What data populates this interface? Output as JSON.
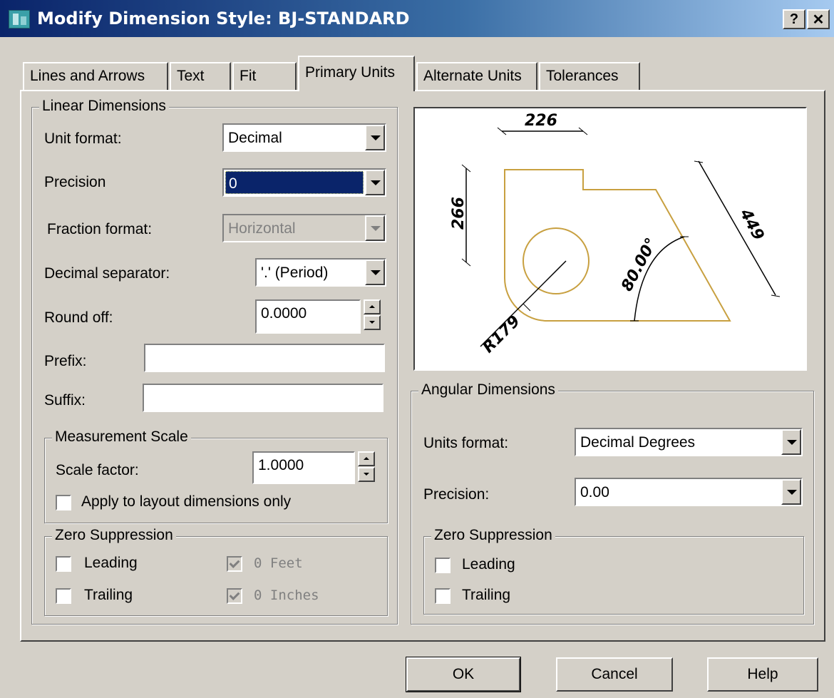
{
  "window": {
    "title": "Modify Dimension Style: BJ-STANDARD",
    "help_glyph": "?",
    "close_glyph": "✕"
  },
  "tabs": [
    {
      "label": "Lines and Arrows",
      "active": false
    },
    {
      "label": "Text",
      "active": false
    },
    {
      "label": "Fit",
      "active": false
    },
    {
      "label": "Primary Units",
      "active": true
    },
    {
      "label": "Alternate Units",
      "active": false
    },
    {
      "label": "Tolerances",
      "active": false
    }
  ],
  "linear": {
    "legend": "Linear Dimensions",
    "unit_format_label": "Unit format:",
    "unit_format_value": "Decimal",
    "precision_label": "Precision",
    "precision_value": "0",
    "fraction_label": "Fraction format:",
    "fraction_value": "Horizontal",
    "decimal_sep_label": "Decimal separator:",
    "decimal_sep_value": "'.' (Period)",
    "round_off_label": "Round off:",
    "round_off_value": "0.0000",
    "prefix_label": "Prefix:",
    "prefix_value": "",
    "suffix_label": "Suffix:",
    "suffix_value": ""
  },
  "measurement": {
    "legend": "Measurement Scale",
    "scale_label": "Scale factor:",
    "scale_value": "1.0000",
    "apply_label": "Apply to layout dimensions only",
    "apply_checked": false
  },
  "zero_linear": {
    "legend": "Zero Suppression",
    "leading": "Leading",
    "trailing": "Trailing",
    "feet": "0 Feet",
    "inches": "0 Inches"
  },
  "preview": {
    "dim_top": "226",
    "dim_left": "266",
    "dim_right": "449",
    "dim_angle": "80.00°",
    "dim_radius": "R179",
    "accent": "#c8a040"
  },
  "angular": {
    "legend": "Angular Dimensions",
    "units_label": "Units format:",
    "units_value": "Decimal Degrees",
    "precision_label": "Precision:",
    "precision_value": "0.00"
  },
  "zero_angular": {
    "legend": "Zero Suppression",
    "leading": "Leading",
    "trailing": "Trailing"
  },
  "buttons": {
    "ok": "OK",
    "cancel": "Cancel",
    "help": "Help"
  }
}
